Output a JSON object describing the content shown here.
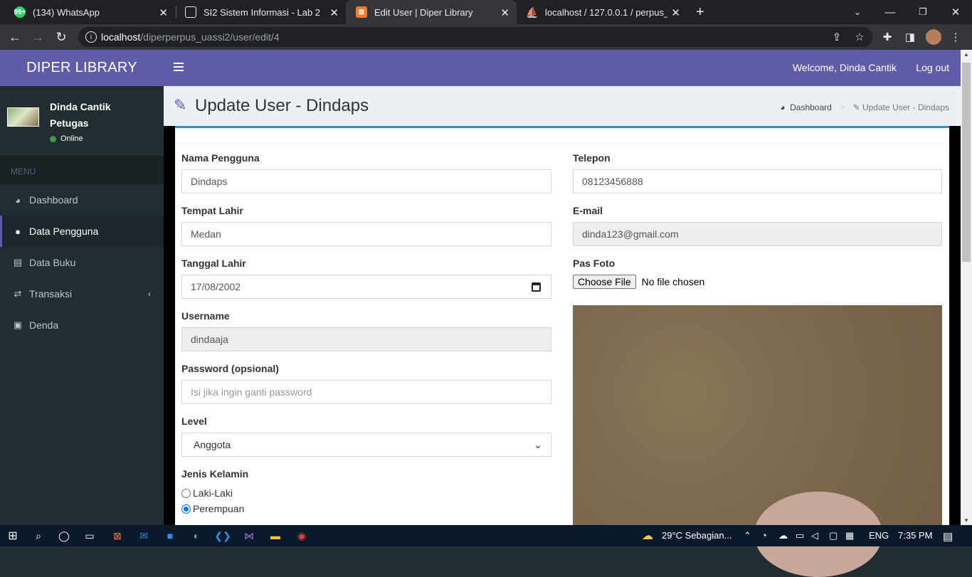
{
  "browser": {
    "tabs": [
      {
        "title": "(134) WhatsApp",
        "favicon": "whatsapp-icon",
        "badge": "99+"
      },
      {
        "title": "SI2 Sistem Informasi - Lab 2",
        "favicon": "page-icon"
      },
      {
        "title": "Edit User | Diper Library",
        "favicon": "xampp-icon"
      },
      {
        "title": "localhost / 127.0.0.1 / perpus_si2",
        "favicon": "phpmyadmin-icon"
      }
    ],
    "url_host": "localhost",
    "url_path": "/diperperpus_uassi2/user/edit/4"
  },
  "app": {
    "logo": "DIPER LIBRARY",
    "welcome": "Welcome, Dinda Cantik",
    "logout": "Log out"
  },
  "sidebar": {
    "user_name": "Dinda Cantik",
    "user_role": "Petugas",
    "status": "Online",
    "menu_header": "MENU",
    "items": [
      {
        "label": "Dashboard",
        "icon": "dashboard-icon"
      },
      {
        "label": "Data Pengguna",
        "icon": "user-icon",
        "active": true
      },
      {
        "label": "Data Buku",
        "icon": "book-icon"
      },
      {
        "label": "Transaksi",
        "icon": "exchange-icon"
      },
      {
        "label": "Denda",
        "icon": "money-icon"
      }
    ]
  },
  "page": {
    "title": "Update User - Dindaps",
    "breadcrumb": [
      "Dashboard",
      "Update User - Dindaps"
    ]
  },
  "form": {
    "nama_label": "Nama Pengguna",
    "nama_value": "Dindaps",
    "tempat_label": "Tempat Lahir",
    "tempat_value": "Medan",
    "tanggal_label": "Tanggal Lahir",
    "tanggal_value": "17/08/2002",
    "username_label": "Username",
    "username_value": "dindaaja",
    "password_label": "Password (opsional)",
    "password_placeholder": "Isi jika ingin ganti password",
    "level_label": "Level",
    "level_value": "Anggota",
    "gender_label": "Jenis Kelamin",
    "gender_options": [
      "Laki-Laki",
      "Perempuan"
    ],
    "gender_selected": "Perempuan",
    "telepon_label": "Telepon",
    "telepon_value": "08123456888",
    "email_label": "E-mail",
    "email_value": "dinda123@gmail.com",
    "foto_label": "Pas Foto",
    "file_button": "Choose File",
    "file_status": "No file chosen"
  },
  "taskbar": {
    "weather": "29°C  Sebagian...",
    "lang": "ENG",
    "time": "7:35 PM"
  },
  "colors": {
    "brand": "#605ca8",
    "sidebar": "#222d32",
    "box_border": "#3c8dbc"
  }
}
